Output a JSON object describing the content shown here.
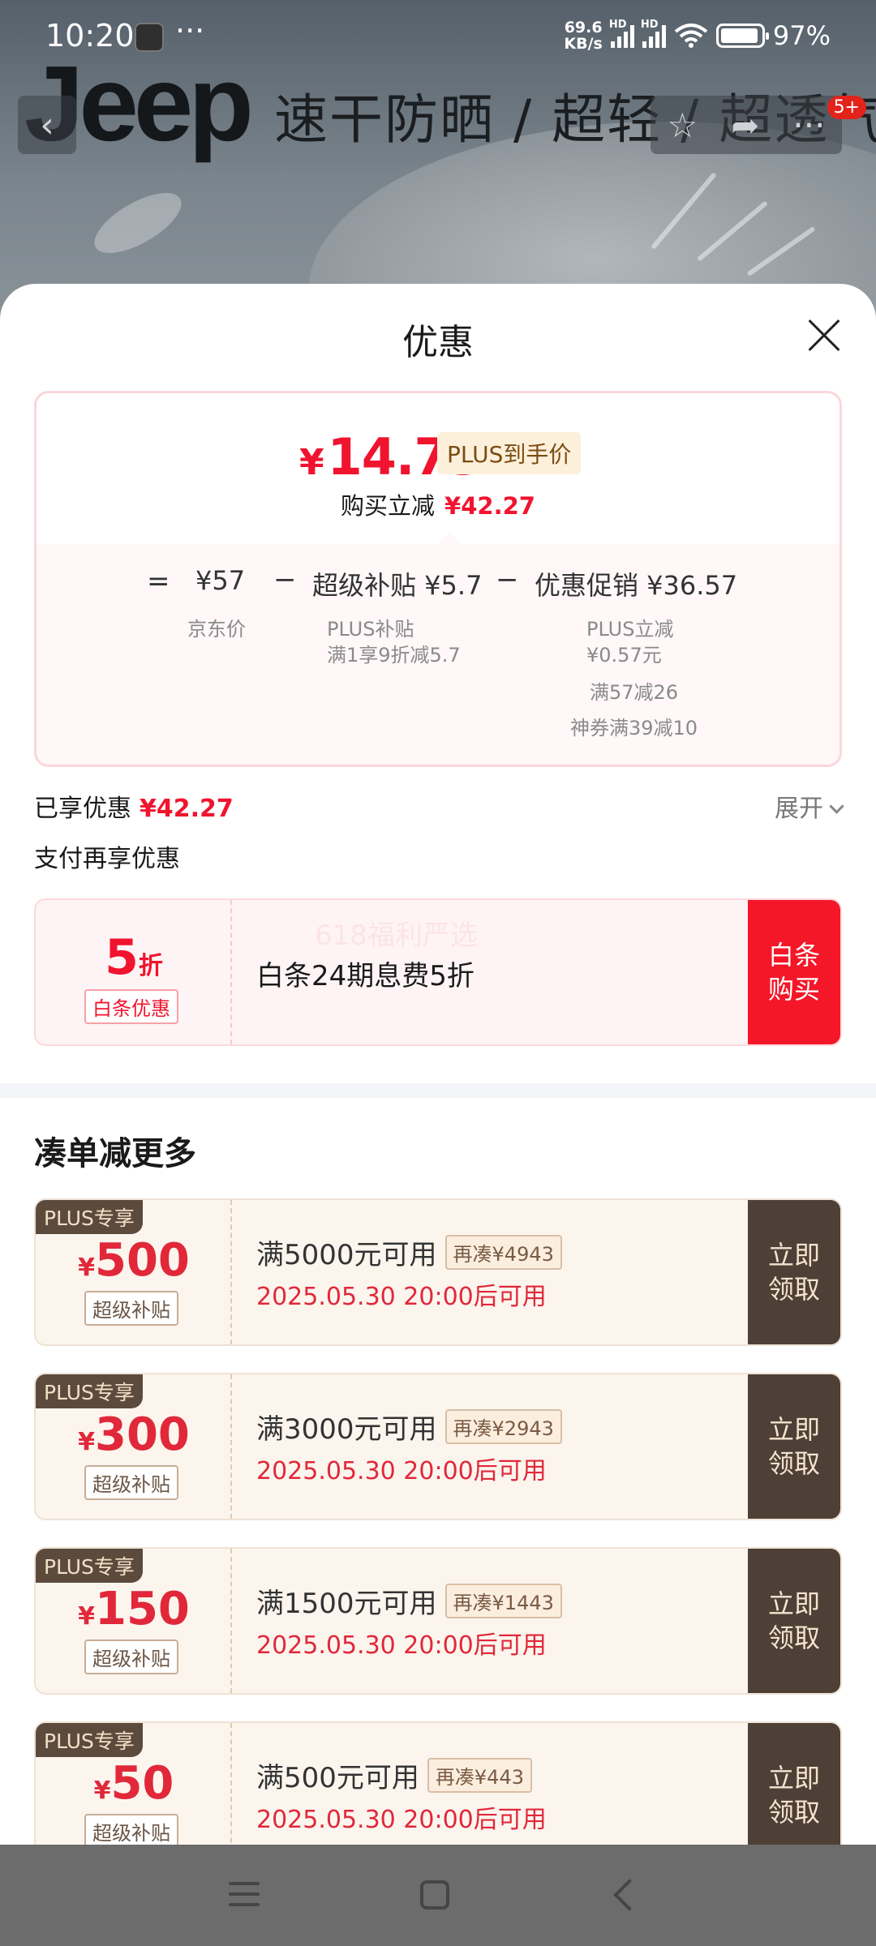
{
  "status_bar": {
    "time": "10:20",
    "more": "···",
    "speed_top": "69.6",
    "speed_bottom": "KB/s",
    "hd": "HD",
    "battery": "97%"
  },
  "header": {
    "brand": "Jeep",
    "banner_text": "速干防晒 / 超轻 / 超透气",
    "cart_badge": "5+",
    "icons": [
      "back-icon",
      "star-icon",
      "share-icon",
      "more-icon"
    ]
  },
  "sheet": {
    "title": "优惠"
  },
  "price_card": {
    "currency": "¥",
    "final_price": "14.73",
    "plus_tag": "PLUS到手价",
    "instant_label": "购买立减",
    "instant_amount": "¥42.27",
    "eq": "=",
    "jd_price": "¥57",
    "jd_price_label": "京东价",
    "minus": "−",
    "subsidy": "超级补贴 ¥5.7",
    "subsidy_sub1": "PLUS补贴",
    "subsidy_sub2": "满1享9折减5.7",
    "promo": "优惠促销 ¥36.57",
    "promo_sub1": "PLUS立减",
    "promo_sub2": "¥0.57元",
    "promo_sub3": "满57减26",
    "promo_sub4": "神券满39减10"
  },
  "enjoyed": {
    "label": "已享优惠",
    "amount": "¥42.27",
    "expand": "展开"
  },
  "pay": {
    "title": "支付再享优惠",
    "value": "5",
    "unit": "折",
    "tag": "白条优惠",
    "watermark": "618福利严选",
    "desc": "白条24期息费5折",
    "button": "白条购买"
  },
  "more_title": "凑单减更多",
  "coupons": [
    {
      "badge": "PLUS专享",
      "yen": "¥",
      "amount": "500",
      "tag": "超级补贴",
      "condition": "满5000元可用",
      "extra": "再凑¥4943",
      "time": "2025.05.30 20:00后可用",
      "button": "立即领取"
    },
    {
      "badge": "PLUS专享",
      "yen": "¥",
      "amount": "300",
      "tag": "超级补贴",
      "condition": "满3000元可用",
      "extra": "再凑¥2943",
      "time": "2025.05.30 20:00后可用",
      "button": "立即领取"
    },
    {
      "badge": "PLUS专享",
      "yen": "¥",
      "amount": "150",
      "tag": "超级补贴",
      "condition": "满1500元可用",
      "extra": "再凑¥1443",
      "time": "2025.05.30 20:00后可用",
      "button": "立即领取"
    },
    {
      "badge": "PLUS专享",
      "yen": "¥",
      "amount": "50",
      "tag": "超级补贴",
      "condition": "满500元可用",
      "extra": "再凑¥443",
      "time": "2025.05.30 20:00后可用",
      "button": "立即领取"
    }
  ],
  "colors": {
    "accent_red": "#f0142f",
    "coupon_brown": "#4e4036"
  }
}
